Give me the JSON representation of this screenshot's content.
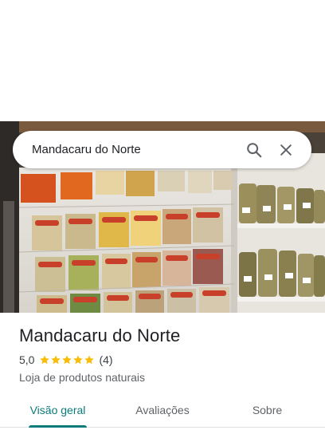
{
  "search": {
    "value": "Mandacaru do Norte",
    "search_icon": "search-icon",
    "close_icon": "close-icon"
  },
  "photo": {
    "subject": "store-shelves-photo"
  },
  "place": {
    "name": "Mandacaru do Norte",
    "rating_value": "5,0",
    "stars": 5,
    "review_count": "(4)",
    "category": "Loja de produtos naturais"
  },
  "tabs": [
    {
      "label": "Visão geral",
      "active": true
    },
    {
      "label": "Avaliações",
      "active": false
    },
    {
      "label": "Sobre",
      "active": false
    }
  ],
  "colors": {
    "accent": "#0b7a7a",
    "star": "#fbbc04"
  }
}
